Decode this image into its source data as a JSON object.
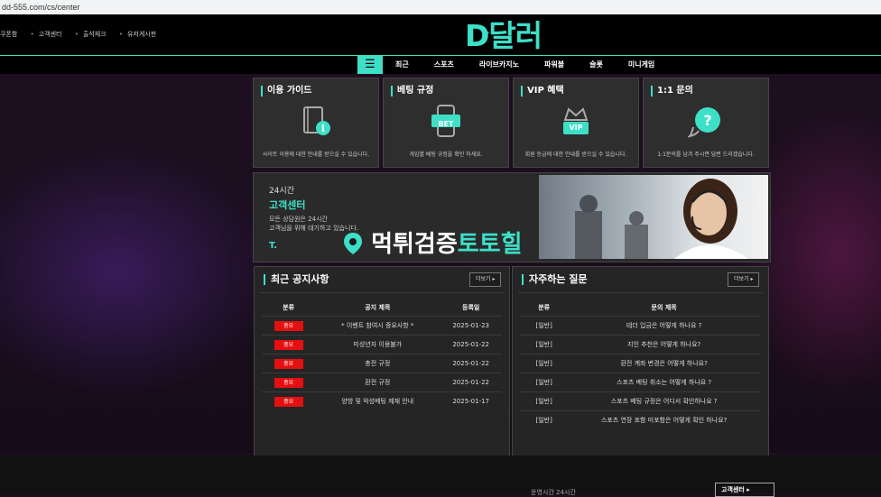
{
  "browser": {
    "url": "dd-555.com/cs/center"
  },
  "header": {
    "top_links": [
      "쿠폰함",
      "고객센터",
      "출석체크",
      "유저게시판"
    ],
    "logo": "D달러",
    "colors": {
      "accent": "#3de0c7",
      "background": "#000000"
    }
  },
  "nav": {
    "menu_icon": "hamburger-icon",
    "items": [
      "최근",
      "스포츠",
      "라이브카지노",
      "파워볼",
      "슬롯",
      "미니게임"
    ]
  },
  "guide_cards": [
    {
      "title": "이용 가이드",
      "icon": "book-info-icon",
      "desc": "사이트 이용에 대한 안내를 받으실 수 있습니다."
    },
    {
      "title": "베팅 규정",
      "icon": "mobile-bet-icon",
      "badge": "BET",
      "desc": "게임별 베팅 규정을 확인 하세요."
    },
    {
      "title": "VIP 혜택",
      "icon": "crown-vip-icon",
      "badge": "VIP",
      "desc": "회원 등급에 대한 안내를 받으실 수 있습니다."
    },
    {
      "title": "1:1 문의",
      "icon": "question-bubble-icon",
      "desc": "1:1문의를 남겨 주시면 답변 드리겠습니다."
    }
  ],
  "banner": {
    "line1": "24시간",
    "title": "고객센터",
    "desc1": "모든 상담원은 24시간",
    "desc2": "고객님을 위해 대기하고 있습니다.",
    "short": "T."
  },
  "watermark": {
    "part1": "먹튀검증",
    "part2": "토토힐",
    "icon": "map-pin-icon"
  },
  "notices": {
    "title": "최근 공지사항",
    "more": "더보기",
    "headers": [
      "분류",
      "공지 제목",
      "등록일"
    ],
    "rows": [
      {
        "tag": "중요",
        "title": "* 이벤트 참여시 중요사항 *",
        "date": "2025-01-23"
      },
      {
        "tag": "중요",
        "title": "미성년자 이용불가",
        "date": "2025-01-22"
      },
      {
        "tag": "중요",
        "title": "충전 규정",
        "date": "2025-01-22"
      },
      {
        "tag": "중요",
        "title": "환전 규정",
        "date": "2025-01-22"
      },
      {
        "tag": "중요",
        "title": "양방 및 악성베팅 제재 안내",
        "date": "2025-01-17"
      }
    ],
    "badge_color": "#e41010"
  },
  "faq": {
    "title": "자주하는 질문",
    "more": "더보기",
    "headers": [
      "분류",
      "문의 제목"
    ],
    "rows": [
      {
        "tag": "[일반]",
        "title": "테더 입금은 어떻게 하나요 ?"
      },
      {
        "tag": "[일반]",
        "title": "지인 추천은 어떻게 하나요?"
      },
      {
        "tag": "[일반]",
        "title": "환전 계좌 변경은 어떻게 하나요?"
      },
      {
        "tag": "[일반]",
        "title": "스포츠 베팅 취소는 어떻게 하나요 ?"
      },
      {
        "tag": "[일반]",
        "title": "스포츠 베팅 규정은 어디서 확인하나요 ?"
      },
      {
        "tag": "[일반]",
        "title": "스포츠 연장 포함 미포함은 어떻게 확인 하나요?"
      }
    ]
  },
  "footer": {
    "text": "운영시간 24시간",
    "cs_button": "고객센터"
  }
}
